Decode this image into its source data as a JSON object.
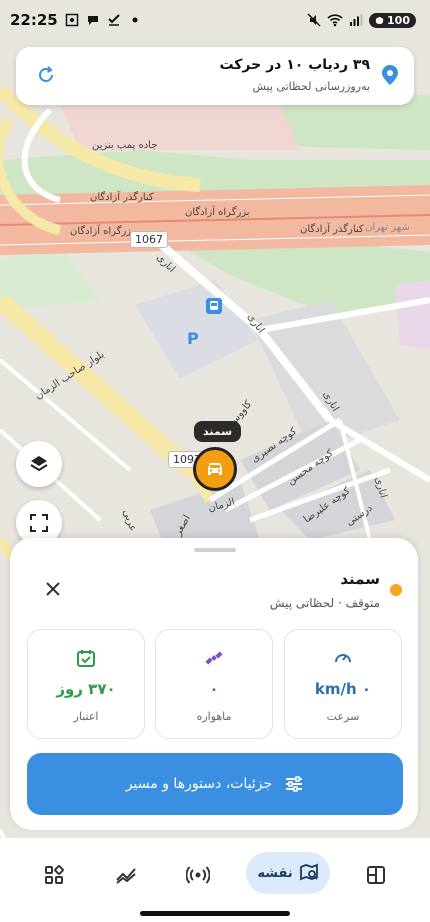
{
  "status_bar": {
    "time": "22:25",
    "battery": "100",
    "icons": [
      "screenshot-icon",
      "chat-icon",
      "check-icon",
      "dot-icon",
      "mute-icon",
      "wifi-icon",
      "signal-icon",
      "battery-icon"
    ]
  },
  "top_card": {
    "title": "۳۹ ردیاب ۱۰ در حرکت",
    "subtitle": "به‌روزرسانی لحظاتی پیش"
  },
  "map": {
    "labels": {
      "street_pump": "جاده پمپ بنزین",
      "azadegan_overpass_1": "کنارگذر آزادگان",
      "azadegan_highway_1": "بزرگراه آزادگان",
      "azadegan_highway_2": "بزرگراه آزادگان",
      "azadegan_overpass_2": "کنارگذر آزادگان",
      "shahr_tehran": "شهر تهران",
      "sahib_alzaman": "بلوار صاحب الزمان",
      "anari_1": "اناری",
      "anari_2": "اناری",
      "anari_3": "اناری",
      "anari_4": "اناری",
      "nasiri": "کوچه نصیری",
      "mohsen": "کوچه محسن",
      "alireza": "کوچه علیرضا",
      "dorosti": "درستی",
      "kavousi": "کاووسی",
      "asghar": "اصغر",
      "arabi": "عربی",
      "alzaman": "الزمان"
    },
    "shield_1067": "1067",
    "shield_1097": "1097",
    "parking": "P",
    "vehicle_tag": "سمند"
  },
  "sheet": {
    "vehicle_name": "سمند",
    "vehicle_status": "متوقف · لحظاتی پیش",
    "stats": [
      {
        "value": "۰ km/h",
        "label": "سرعت",
        "color": "#2f6fb0"
      },
      {
        "value": "۰",
        "label": "ماهواره",
        "color": "#7a4fc9"
      },
      {
        "value": "۳۷۰ روز",
        "label": "اعتبار",
        "color": "#2e9b4a"
      }
    ],
    "details_button": "جزئیات، دستورها و مسیر"
  },
  "nav": {
    "active_label": "نقشه",
    "items": [
      "layout-icon",
      "map-search-icon",
      "broadcast-icon",
      "chart-icon",
      "apps-icon"
    ]
  }
}
